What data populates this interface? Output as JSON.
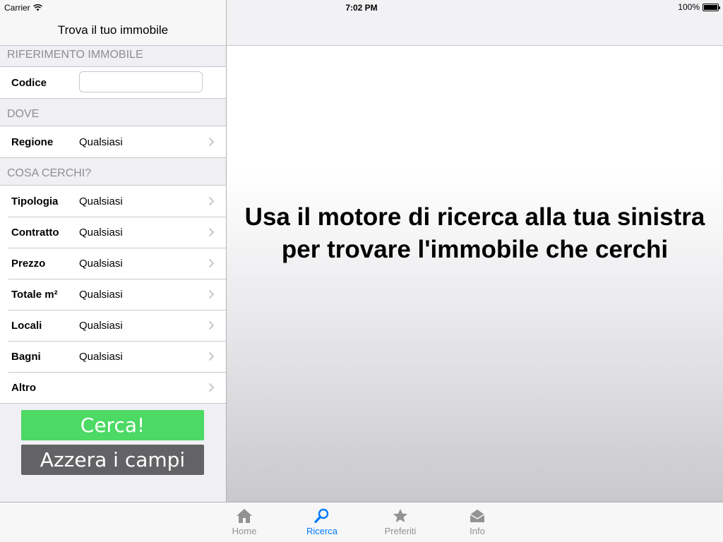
{
  "status_bar": {
    "carrier": "Carrier",
    "time": "7:02 PM",
    "battery": "100%"
  },
  "nav": {
    "title": "Trova il tuo immobile"
  },
  "sections": {
    "riferimento": "RIFERIMENTO IMMOBILE",
    "dove": "DOVE",
    "cosa": "COSA CERCHI?"
  },
  "codice": {
    "label": "Codice",
    "value": "",
    "placeholder": ""
  },
  "regione": {
    "label": "Regione",
    "value": "Qualsiasi"
  },
  "filters": [
    {
      "label": "Tipologia",
      "value": "Qualsiasi"
    },
    {
      "label": "Contratto",
      "value": "Qualsiasi"
    },
    {
      "label": "Prezzo",
      "value": "Qualsiasi"
    },
    {
      "label": "Totale m²",
      "value": "Qualsiasi"
    },
    {
      "label": "Locali",
      "value": "Qualsiasi"
    },
    {
      "label": "Bagni",
      "value": "Qualsiasi"
    },
    {
      "label": "Altro",
      "value": ""
    }
  ],
  "buttons": {
    "search": "Cerca!",
    "reset": "Azzera i campi"
  },
  "hint": {
    "line1": "Usa il motore di ricerca alla tua sinistra",
    "line2": "per trovare l'immobile che cerchi"
  },
  "tabs": [
    {
      "label": "Home",
      "icon": "home-icon",
      "active": false
    },
    {
      "label": "Ricerca",
      "icon": "search-icon",
      "active": true
    },
    {
      "label": "Preferiti",
      "icon": "star-icon",
      "active": false
    },
    {
      "label": "Info",
      "icon": "envelope-icon",
      "active": false
    }
  ],
  "colors": {
    "accent": "#007aff",
    "search_button": "#4cd964",
    "reset_button": "#636366",
    "section_text": "#8e8e93"
  }
}
